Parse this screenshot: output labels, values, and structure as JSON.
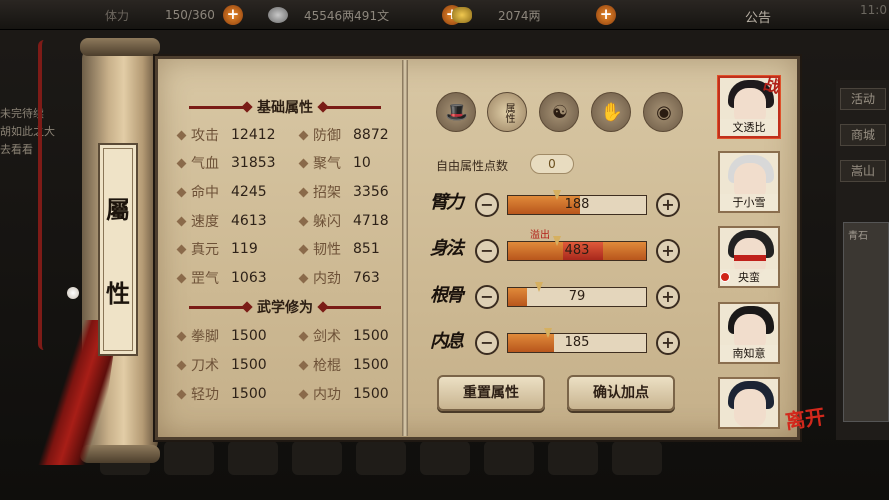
{
  "topbar": {
    "stamina": "150/360",
    "silver": "45546两491文",
    "gold": "2074两",
    "notice": "公告",
    "time": "11:0"
  },
  "left_bg": {
    "line1": "未完待续",
    "line2": "胡如此之大",
    "line3": "去看看"
  },
  "right_menu": {
    "activity": "活动",
    "shop": "商城",
    "mountain": "嵩山",
    "note": "青石"
  },
  "title_card": [
    "屬",
    "性"
  ],
  "basic": {
    "header": "基础属性",
    "stats": [
      {
        "label": "攻击",
        "value": "12412"
      },
      {
        "label": "防御",
        "value": "8872"
      },
      {
        "label": "气血",
        "value": "31853"
      },
      {
        "label": "聚气",
        "value": "10"
      },
      {
        "label": "命中",
        "value": "4245"
      },
      {
        "label": "招架",
        "value": "3356"
      },
      {
        "label": "速度",
        "value": "4613"
      },
      {
        "label": "躲闪",
        "value": "4718"
      },
      {
        "label": "真元",
        "value": "119"
      },
      {
        "label": "韧性",
        "value": "851"
      },
      {
        "label": "罡气",
        "value": "1063"
      },
      {
        "label": "内劲",
        "value": "763"
      }
    ]
  },
  "martial": {
    "header": "武学修为",
    "stats": [
      {
        "label": "拳脚",
        "value": "1500"
      },
      {
        "label": "剑术",
        "value": "1500"
      },
      {
        "label": "刀术",
        "value": "1500"
      },
      {
        "label": "枪棍",
        "value": "1500"
      },
      {
        "label": "轻功",
        "value": "1500"
      },
      {
        "label": "内功",
        "value": "1500"
      }
    ]
  },
  "categories": [
    "属性"
  ],
  "free_points": {
    "label": "自由属性点数",
    "value": "0"
  },
  "attributes": [
    {
      "label": "臂力",
      "value": "188",
      "fill": 0.52
    },
    {
      "label": "身法",
      "value": "483",
      "fill": 1.0,
      "overflow": "溢出"
    },
    {
      "label": "根骨",
      "value": "79",
      "fill": 0.14
    },
    {
      "label": "内息",
      "value": "185",
      "fill": 0.33
    }
  ],
  "buttons": {
    "reset": "重置属性",
    "confirm": "确认加点"
  },
  "party": [
    {
      "name": "文透比",
      "badge": "战"
    },
    {
      "name": "于小雪"
    },
    {
      "name": "央蛮"
    },
    {
      "name": "南知意"
    },
    {
      "name": ""
    }
  ],
  "leave": "离开",
  "colors": {
    "accent_red": "#b22018",
    "bar_fill": "#e08a3a",
    "parchment": "#d8c7a4"
  }
}
